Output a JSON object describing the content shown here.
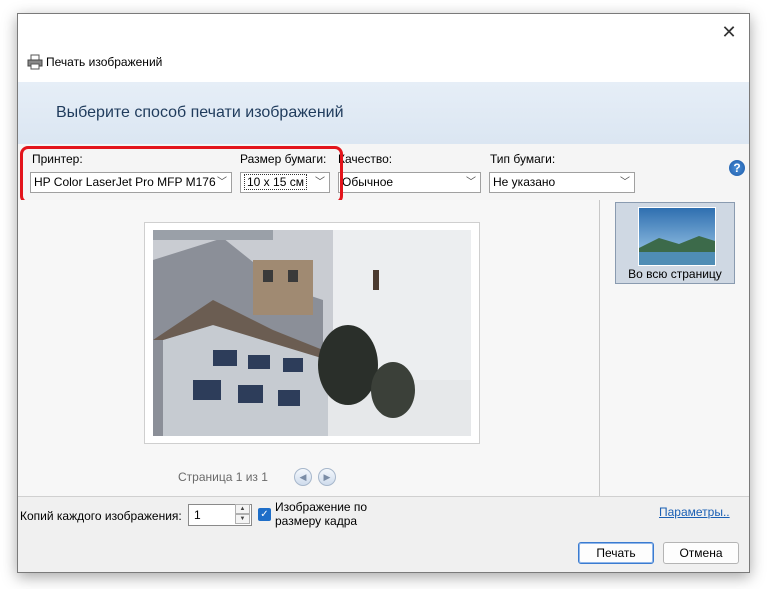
{
  "window": {
    "title": "Печать изображений",
    "close_glyph": "✕"
  },
  "banner": {
    "heading": "Выберите способ печати изображений"
  },
  "options": {
    "printer_label": "Принтер:",
    "printer_value": "HP Color LaserJet Pro MFP M176",
    "paper_size_label": "Размер бумаги:",
    "paper_size_value": "10 x 15 см",
    "quality_label": "Качество:",
    "quality_value": "Обычное",
    "paper_type_label": "Тип бумаги:",
    "paper_type_value": "Не указано",
    "help_glyph": "?",
    "highlight_color": "#e3141b"
  },
  "preview": {
    "page_info": "Страница 1 из 1",
    "prev_glyph": "◀",
    "next_glyph": "▶"
  },
  "layouts": {
    "selected_label": "Во всю страницу"
  },
  "bottom": {
    "copies_label": "Копий каждого изображения:",
    "copies_value": "1",
    "fit_label_line1": "Изображение по",
    "fit_label_line2": "размеру кадра",
    "fit_checked": true,
    "options_link": "Параметры..",
    "print_button": "Печать",
    "cancel_button": "Отмена"
  },
  "icons": [
    "printer-icon",
    "close-icon",
    "help-icon",
    "chevron-down-icon",
    "arrow-left-icon",
    "arrow-right-icon",
    "checkbox-checked-icon"
  ]
}
